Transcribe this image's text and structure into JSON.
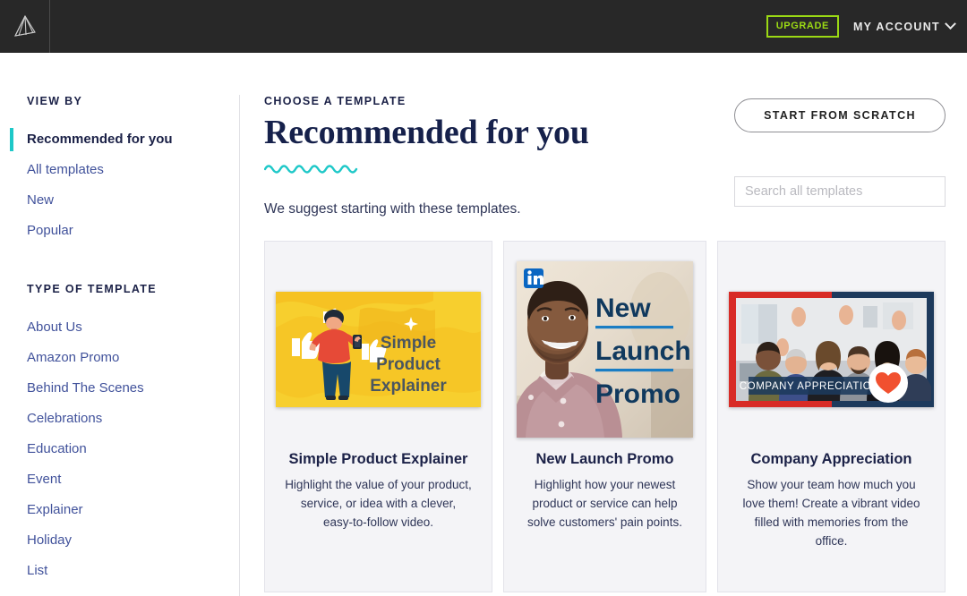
{
  "topnav": {
    "logo_icon": "fan-triangle-logo-icon",
    "upgrade_label": "UPGRADE",
    "account_label": "MY ACCOUNT",
    "chevron_icon": "chevron-down-icon"
  },
  "sidebar": {
    "view_by_heading": "VIEW BY",
    "view_by_items": [
      {
        "label": "Recommended for you",
        "active": true
      },
      {
        "label": "All templates",
        "active": false
      },
      {
        "label": "New",
        "active": false
      },
      {
        "label": "Popular",
        "active": false
      }
    ],
    "type_heading": "TYPE OF TEMPLATE",
    "type_items": [
      {
        "label": "About Us"
      },
      {
        "label": "Amazon Promo"
      },
      {
        "label": "Behind The Scenes"
      },
      {
        "label": "Celebrations"
      },
      {
        "label": "Education"
      },
      {
        "label": "Event"
      },
      {
        "label": "Explainer"
      },
      {
        "label": "Holiday"
      },
      {
        "label": "List"
      }
    ]
  },
  "main": {
    "eyebrow": "CHOOSE A TEMPLATE",
    "title": "Recommended for you",
    "subtitle": "We suggest starting with these templates.",
    "start_from_scratch_label": "START FROM SCRATCH",
    "search_placeholder": "Search all templates",
    "search_value": ""
  },
  "cards": [
    {
      "title": "Simple Product Explainer",
      "description": "Highlight the value of your product, service, or idea with a clever, easy-to-follow video.",
      "thumb_text_lines": [
        "Simple",
        "Product",
        "Explainer"
      ],
      "thumb_kind": "illustration-yellow"
    },
    {
      "title": "New Launch Promo",
      "description": "Highlight how your newest product or service can help solve customers' pain points.",
      "thumb_text_lines": [
        "New",
        "Launch",
        "Promo"
      ],
      "thumb_kind": "photo-square-linkedin",
      "badge_icon": "linkedin-icon"
    },
    {
      "title": "Company Appreciation",
      "description": "Show your team how much you love them! Create a vibrant video filled with memories from the office.",
      "thumb_banner_text": "COMPANY APPRECIATION",
      "thumb_kind": "photo-team-heart",
      "badge_icon": "heart-icon"
    }
  ],
  "colors": {
    "nav_bg": "#282828",
    "upgrade_green": "#9bd914",
    "accent_teal": "#1ec8c8",
    "link_blue": "#41529b",
    "title_navy": "#16214b",
    "card_bg": "#f4f4f7",
    "thumb_yellow": "#f7cf2e",
    "heart_orange": "#f1502f",
    "linkedin_blue": "#0a66c2",
    "frame_red": "#d82b26",
    "frame_navy": "#1d3a5c"
  }
}
